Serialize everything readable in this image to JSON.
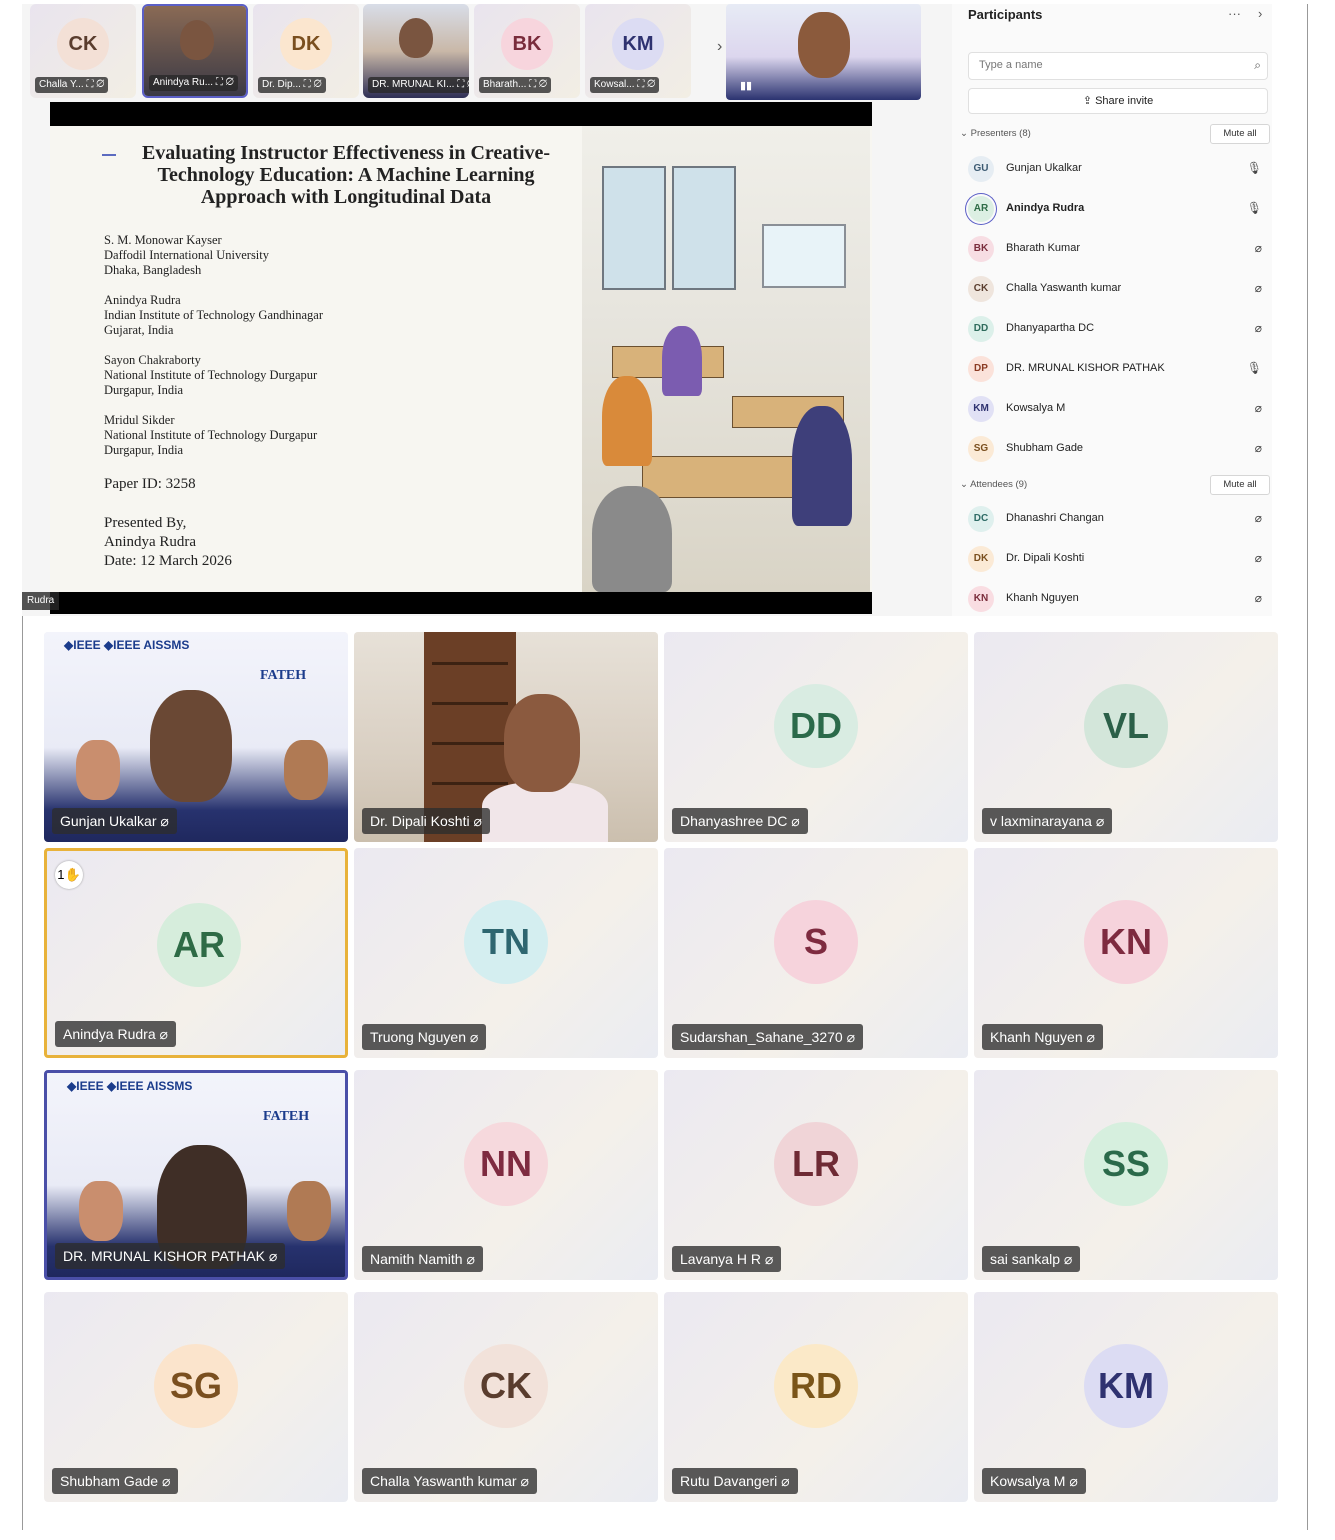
{
  "thumbnails": [
    {
      "initials": "CK",
      "label": "Challa Y...",
      "color": "#f3e0d6",
      "text_color": "#5a3d2e"
    },
    {
      "initials": "",
      "label": "Anindya Ru...",
      "selected": true
    },
    {
      "initials": "DK",
      "label": "Dr. Dip...",
      "color": "#fbe6cf",
      "text_color": "#7a4f1f"
    },
    {
      "initials": "",
      "label": "DR. MRUNAL KI..."
    },
    {
      "initials": "BK",
      "label": "Bharath...",
      "color": "#f7d5dd",
      "text_color": "#7a2d3c"
    },
    {
      "initials": "KM",
      "label": "Kowsal...",
      "color": "#dcdcf3",
      "text_color": "#2f3270"
    }
  ],
  "next_arrow": "›",
  "slide": {
    "title": "Evaluating Instructor Effectiveness in Creative-Technology Education: A Machine Learning Approach with Longitudinal Data",
    "authors": [
      {
        "name": "S. M. Monowar Kayser",
        "inst": "Daffodil International University",
        "place": "Dhaka, Bangladesh"
      },
      {
        "name": "Anindya Rudra",
        "inst": "Indian Institute of Technology Gandhinagar",
        "place": "Gujarat, India"
      },
      {
        "name": "Sayon Chakraborty",
        "inst": "National Institute of Technology Durgapur",
        "place": "Durgapur, India"
      },
      {
        "name": "Mridul Sikder",
        "inst": "National Institute of Technology Durgapur",
        "place": "Durgapur, India"
      }
    ],
    "paper_id": "Paper ID: 3258",
    "presented_by": "Presented By,",
    "presenter": "Anindya Rudra",
    "date": "Date: 12 March 2026"
  },
  "presenter_label": "Rudra",
  "panel": {
    "title": "Participants",
    "more": "···",
    "close": "›",
    "search_placeholder": "Type a name",
    "share_invite": "Share invite",
    "presenters_section": "Presenters (8)",
    "attendees_section": "Attendees (9)",
    "mute_all": "Mute all",
    "presenters": [
      {
        "initials": "GU",
        "name": "Gunjan Ukalkar",
        "color": "#e6edf3",
        "text": "#3c5a72",
        "mic": "on"
      },
      {
        "initials": "AR",
        "name": "Anindya Rudra",
        "color": "#dcefe3",
        "text": "#2e6b46",
        "mic": "on",
        "bold": true,
        "ring": true
      },
      {
        "initials": "BK",
        "name": "Bharath Kumar",
        "color": "#f7dde3",
        "text": "#7a2d3c",
        "mic": "off"
      },
      {
        "initials": "CK",
        "name": "Challa Yaswanth kumar",
        "color": "#efe5dd",
        "text": "#5a3d2e",
        "mic": "off"
      },
      {
        "initials": "DD",
        "name": "Dhanyapartha DC",
        "color": "#dcf0ea",
        "text": "#2e6b5c",
        "mic": "off"
      },
      {
        "initials": "DP",
        "name": "DR. MRUNAL KISHOR PATHAK",
        "color": "#fbe2da",
        "text": "#8a3a22",
        "mic": "on"
      },
      {
        "initials": "KM",
        "name": "Kowsalya M",
        "color": "#e1e1f5",
        "text": "#2f3270",
        "mic": "off"
      },
      {
        "initials": "SG",
        "name": "Shubham Gade",
        "color": "#fbead6",
        "text": "#7a4f1f",
        "mic": "off"
      }
    ],
    "attendees": [
      {
        "initials": "DC",
        "name": "Dhanashri Changan",
        "color": "#dff0ee",
        "text": "#2e6b66",
        "mic": "off"
      },
      {
        "initials": "DK",
        "name": "Dr. Dipali Koshti",
        "color": "#fbead6",
        "text": "#7a4f1f",
        "mic": "off"
      },
      {
        "initials": "KN",
        "name": "Khanh Nguyen",
        "color": "#f9dde2",
        "text": "#7a2d3c",
        "mic": "off"
      }
    ]
  },
  "gallery": [
    {
      "initials": "",
      "label": "Gunjan Ukalkar",
      "kind": "banner1"
    },
    {
      "initials": "",
      "label": "Dr. Dipali Koshti",
      "kind": "room"
    },
    {
      "initials": "DD",
      "label": "Dhanyashree DC",
      "color": "#d9ece2",
      "text": "#2b6a4a"
    },
    {
      "initials": "VL",
      "label": "v laxminarayana",
      "color": "#d3e6da",
      "text": "#2b6048"
    },
    {
      "initials": "AR",
      "label": "Anindya Rudra",
      "color": "#d6eddc",
      "text": "#2e6b46",
      "hand": "1✋",
      "border": "raised"
    },
    {
      "initials": "TN",
      "label": "Truong Nguyen",
      "color": "#d4eef0",
      "text": "#2e6670"
    },
    {
      "initials": "S",
      "label": "Sudarshan_Sahane_3270",
      "color": "#f6d3dc",
      "text": "#7e2b40"
    },
    {
      "initials": "KN",
      "label": "Khanh Nguyen",
      "color": "#f6d3dc",
      "text": "#7e2b40"
    },
    {
      "initials": "",
      "label": "DR. MRUNAL KISHOR PATHAK",
      "kind": "banner2",
      "border": "speaking"
    },
    {
      "initials": "NN",
      "label": "Namith Namith",
      "color": "#f6d9dd",
      "text": "#7e2b40"
    },
    {
      "initials": "LR",
      "label": "Lavanya H R",
      "color": "#f0d4d7",
      "text": "#6e2a34"
    },
    {
      "initials": "SS",
      "label": "sai sankalp",
      "color": "#d6efde",
      "text": "#2b6a4a"
    },
    {
      "initials": "SG",
      "label": "Shubham Gade",
      "color": "#fbe4cc",
      "text": "#7a4f1f"
    },
    {
      "initials": "CK",
      "label": "Challa Yaswanth kumar",
      "color": "#f2e2da",
      "text": "#5a3d2e"
    },
    {
      "initials": "RD",
      "label": "Rutu Davangeri",
      "color": "#fbe9c8",
      "text": "#7a5519"
    },
    {
      "initials": "KM",
      "label": "Kowsalya M",
      "color": "#dcdcf3",
      "text": "#2f3270"
    }
  ],
  "banner": {
    "logos": "◆IEEE ◆IEEE  AISSMS",
    "fateh": "FATEH"
  }
}
